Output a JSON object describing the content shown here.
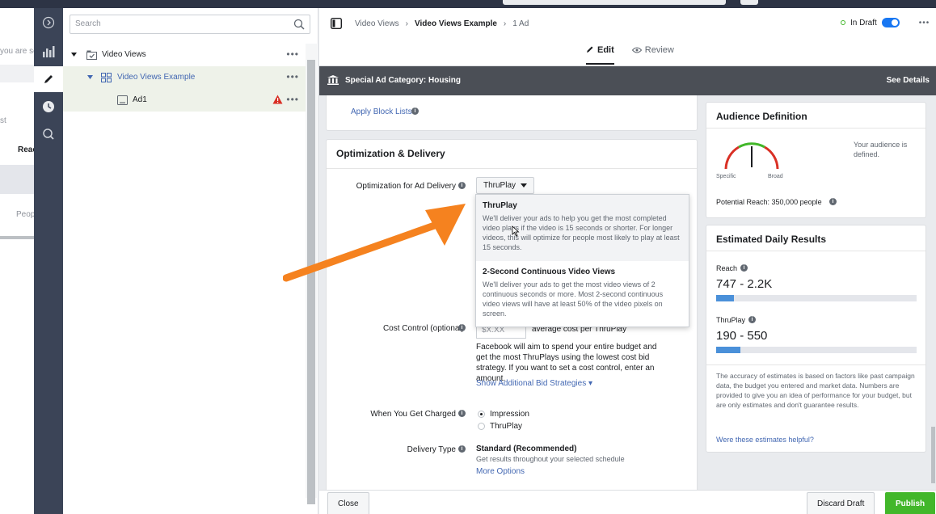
{
  "left_panel": {
    "texts": [
      "you are se",
      "st",
      "Reac",
      "Peop"
    ]
  },
  "tree": {
    "search_placeholder": "Search",
    "items": [
      {
        "label": "Video Views"
      },
      {
        "label": "Video Views Example"
      },
      {
        "label": "Ad1"
      }
    ]
  },
  "header": {
    "breadcrumb": [
      "Video Views",
      "Video Views Example",
      "1 Ad"
    ],
    "draft_status": "In Draft",
    "tabs": {
      "edit": "Edit",
      "review": "Review"
    }
  },
  "category_bar": {
    "label": "Special Ad Category: Housing",
    "see_details": "See Details"
  },
  "form": {
    "apply_block_lists": "Apply Block Lists",
    "section_title": "Optimization & Delivery",
    "optimization_label": "Optimization for Ad Delivery",
    "optimization_value": "ThruPlay",
    "dropdown_options": [
      {
        "title": "ThruPlay",
        "desc": "We'll deliver your ads to help you get the most completed video plays if the video is 15 seconds or shorter. For longer videos, this will optimize for people most likely to play at least 15 seconds."
      },
      {
        "title": "2-Second Continuous Video Views",
        "desc": "We'll deliver your ads to get the most video views of 2 continuous seconds or more. Most 2-second continuous video views will have at least 50% of the video pixels on screen."
      }
    ],
    "cost_control_label": "Cost Control (optional)",
    "cost_placeholder": "$X.XX",
    "cost_suffix": "average cost per ThruPlay",
    "cost_help": "Facebook will aim to spend your entire budget and get the most ThruPlays using the lowest cost bid strategy. If you want to set a cost control, enter an amount.",
    "bid_link": "Show Additional Bid Strategies",
    "charged_label": "When You Get Charged",
    "charged_options": [
      "Impression",
      "ThruPlay"
    ],
    "delivery_label": "Delivery Type",
    "delivery_value": "Standard (Recommended)",
    "delivery_help": "Get results throughout your selected schedule",
    "more_options": "More Options"
  },
  "audience": {
    "title": "Audience Definition",
    "status": "Your audience is defined.",
    "gauge_left": "Specific",
    "gauge_right": "Broad",
    "reach": "Potential Reach: 350,000 people"
  },
  "results": {
    "title": "Estimated Daily Results",
    "metrics": [
      {
        "label": "Reach",
        "value": "747 - 2.2K",
        "fill": 0.09
      },
      {
        "label": "ThruPlay",
        "value": "190 - 550",
        "fill": 0.12
      }
    ],
    "disclaimer": "The accuracy of estimates is based on factors like past campaign data, the budget you entered and market data. Numbers are provided to give you an idea of performance for your budget, but are only estimates and don't guarantee results.",
    "helpful_link": "Were these estimates helpful?"
  },
  "footer": {
    "close": "Close",
    "discard": "Discard Draft",
    "publish": "Publish"
  },
  "colors": {
    "accent_blue": "#4267b2",
    "publish_green": "#42b72a",
    "arrow_orange": "#f5821f",
    "alert_red": "#d93025"
  }
}
